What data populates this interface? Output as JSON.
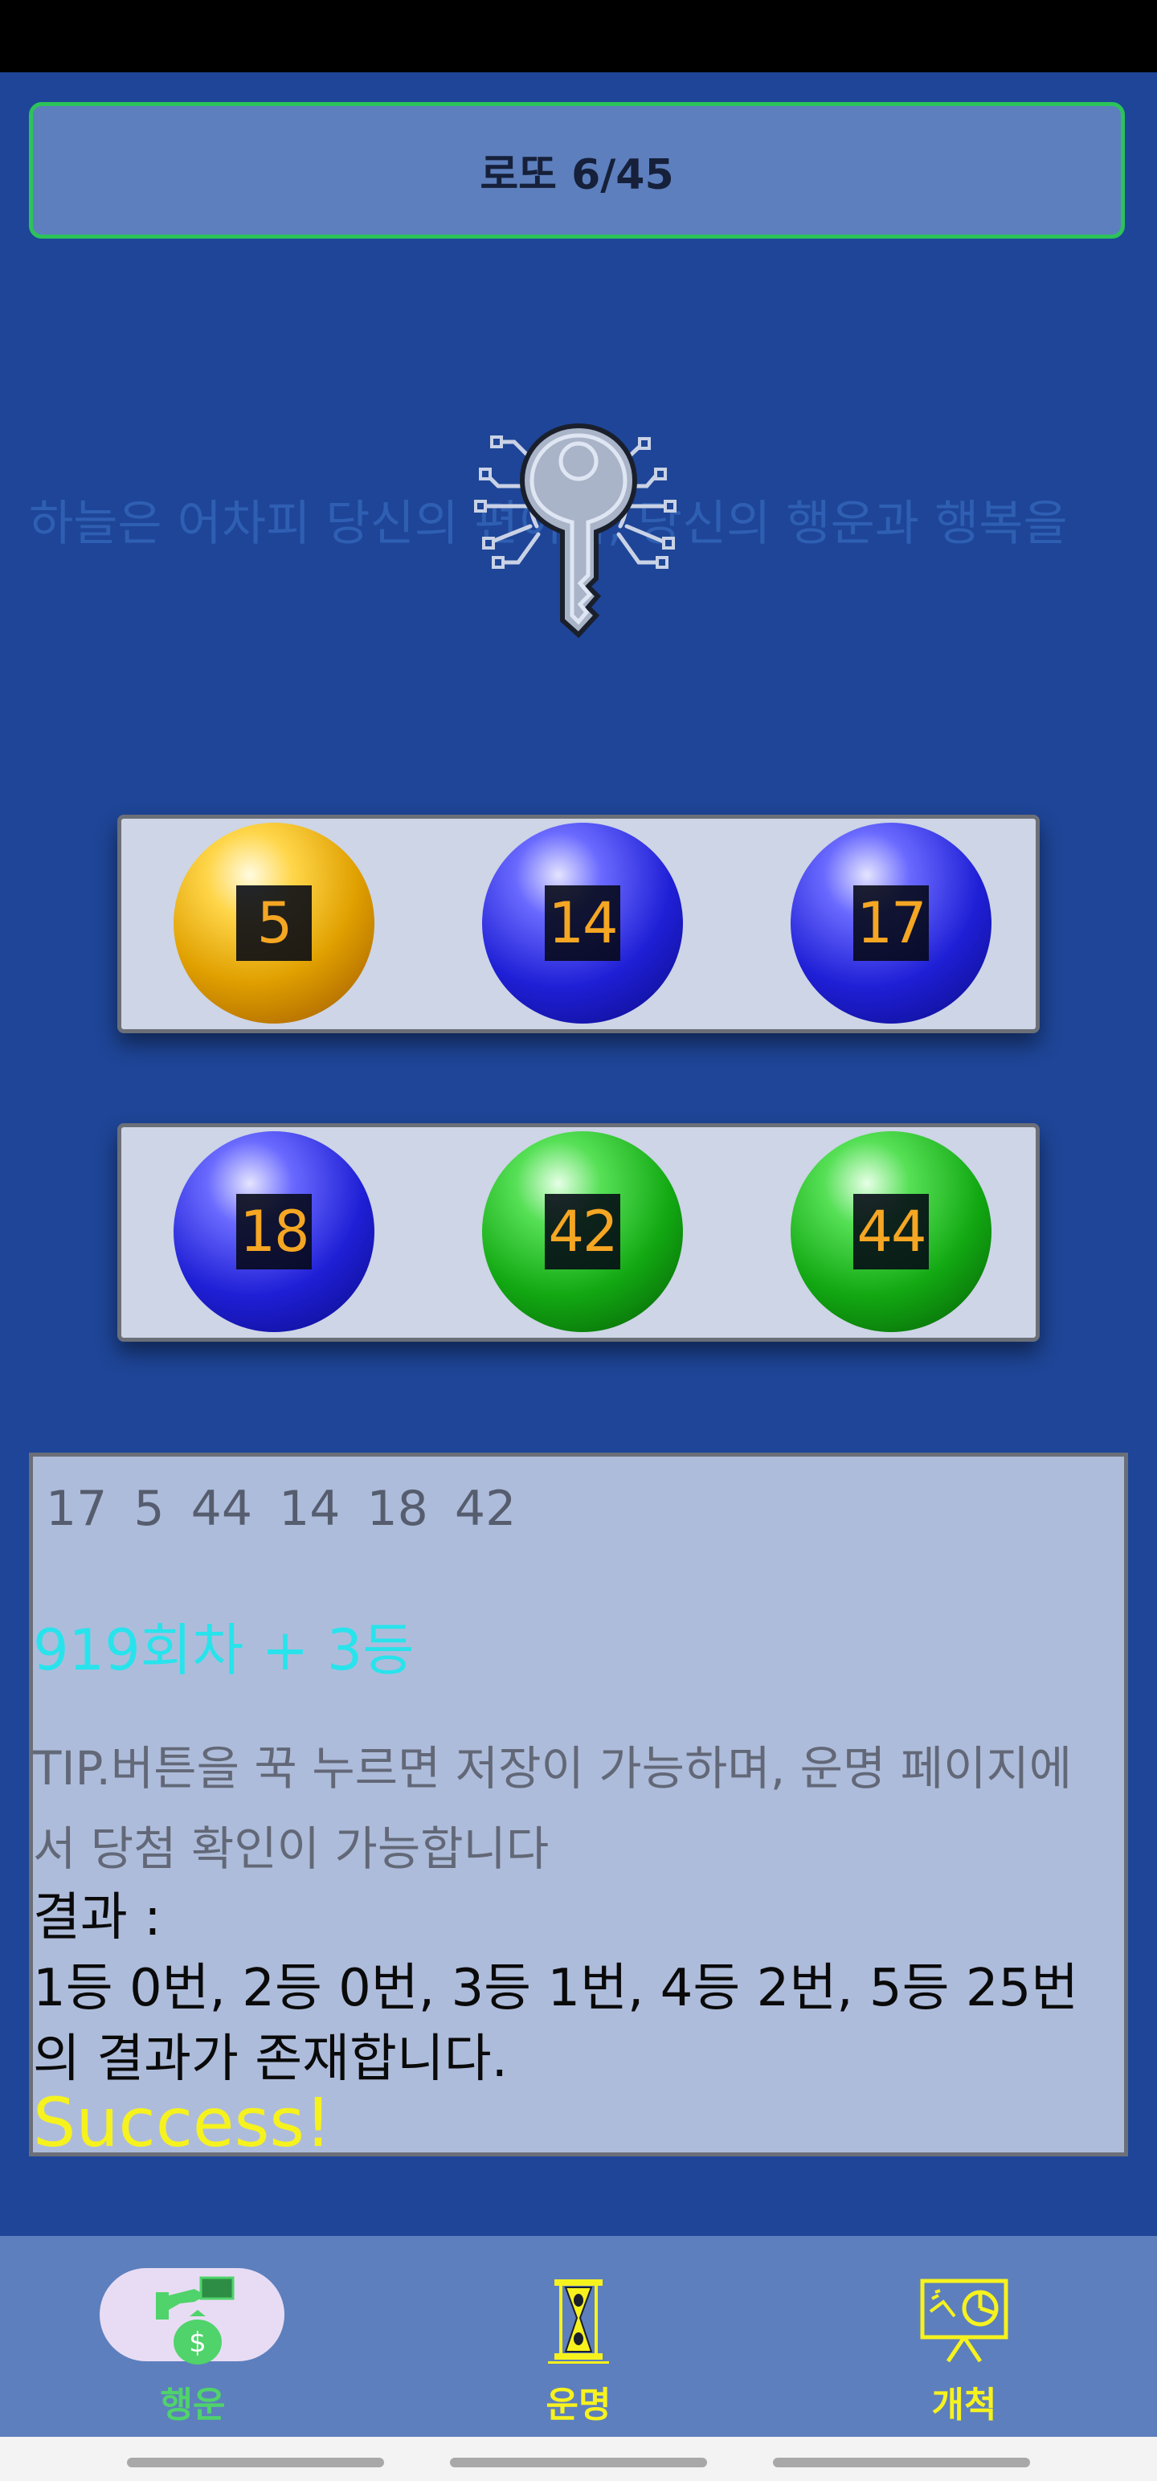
{
  "header": {
    "title": "로또 6/45"
  },
  "marquee": {
    "text": "하늘은 어차피 당신의 편이며, 당신의 행운과 행복을"
  },
  "balls": {
    "row1": [
      {
        "number": "5",
        "color": "gold"
      },
      {
        "number": "14",
        "color": "blue"
      },
      {
        "number": "17",
        "color": "blue"
      }
    ],
    "row2": [
      {
        "number": "18",
        "color": "blue"
      },
      {
        "number": "42",
        "color": "green"
      },
      {
        "number": "44",
        "color": "green"
      }
    ]
  },
  "result": {
    "numbers": "17  5  44  14  18  42",
    "draw_rank": "919회차 + 3등",
    "tip": "TIP.버튼을 꾹 누르면 저장이 가능하며, 운명 페이지에서 당첨 확인이 가능합니다",
    "result_label": "결과 :",
    "result_detail": "1등 0번, 2등 0번, 3등 1번, 4등 2번, 5등 25번의 결과가 존재합니다.",
    "success": "Success!"
  },
  "nav": {
    "items": [
      {
        "label": "행운",
        "icon": "money-bag-icon",
        "selected": true
      },
      {
        "label": "운명",
        "icon": "hourglass-icon",
        "selected": false
      },
      {
        "label": "개척",
        "icon": "presentation-chart-icon",
        "selected": false
      }
    ]
  },
  "colors": {
    "background": "#1e4597",
    "panel": "#5d7fbd",
    "accent_green": "#2cc35a",
    "draw_rank": "#28e3ec",
    "success": "#f6f21e",
    "nav_inactive": "#f6f21e",
    "nav_active": "#4fd36a"
  }
}
